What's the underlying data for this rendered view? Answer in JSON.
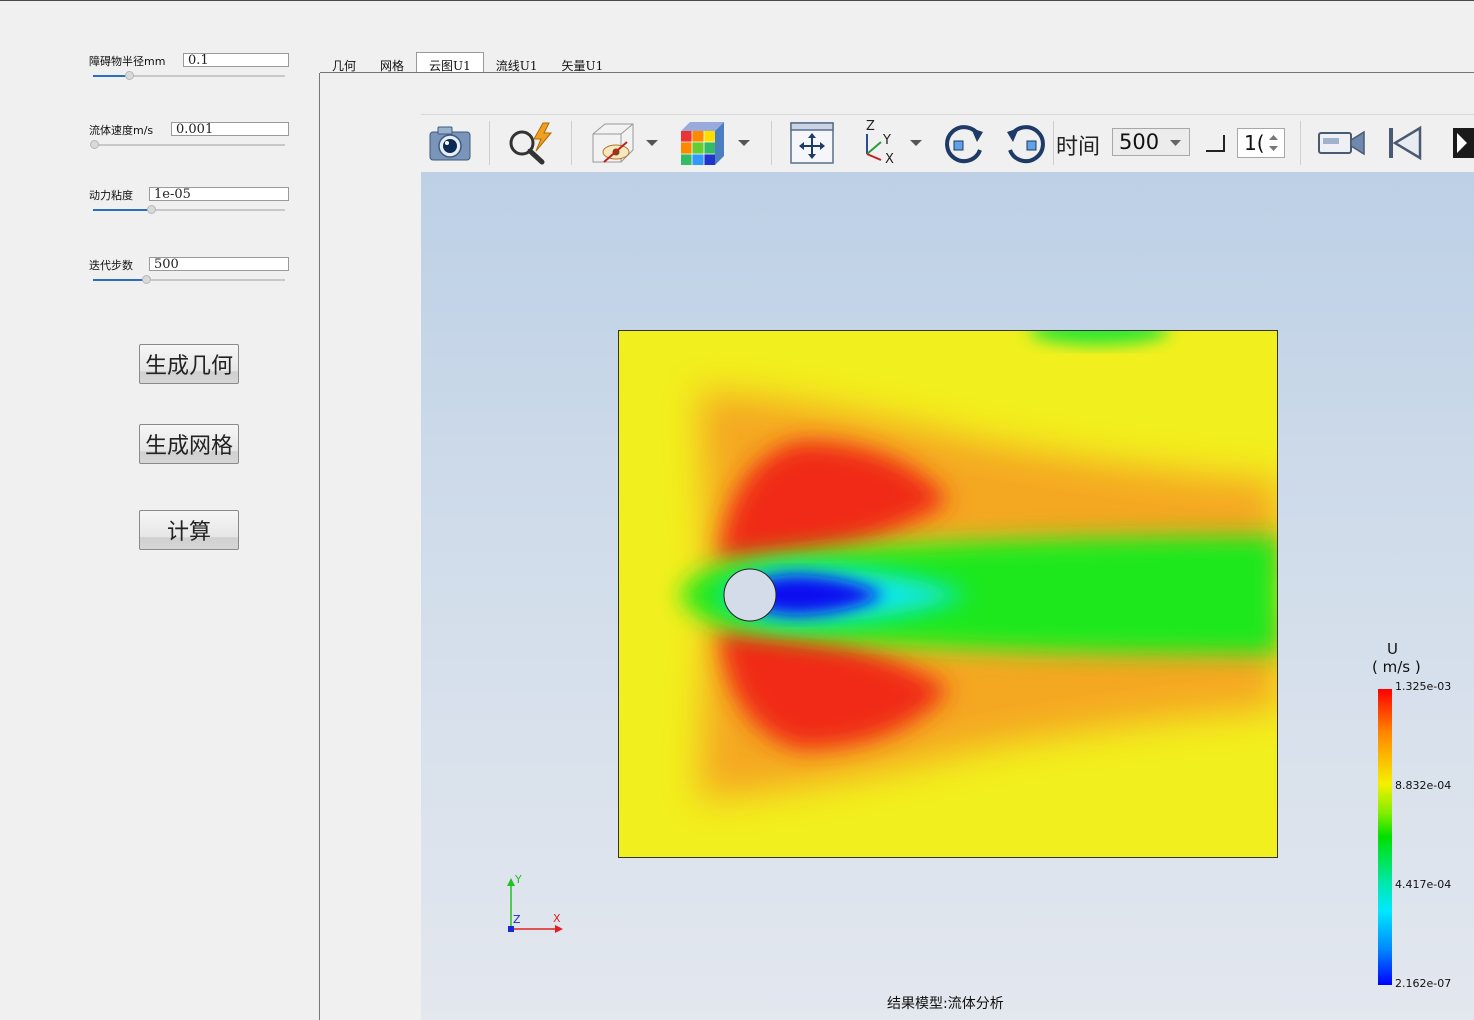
{
  "params": [
    {
      "label": "障碍物半径mm",
      "value": "0.1"
    },
    {
      "label": "流体速度m/s",
      "value": "0.001"
    },
    {
      "label": "动力粘度",
      "value": "1e-05"
    },
    {
      "label": "迭代步数",
      "value": "500"
    }
  ],
  "actions": {
    "geometry": "生成几何",
    "mesh": "生成网格",
    "compute": "计算"
  },
  "tabs": [
    {
      "label": "几何"
    },
    {
      "label": "网格"
    },
    {
      "label": "云图U1",
      "active": true
    },
    {
      "label": "流线U1"
    },
    {
      "label": "矢量U1"
    }
  ],
  "toolbar": {
    "time_label": "时间",
    "time_value": "500",
    "step_value": "1("
  },
  "axes": {
    "y": "Y",
    "z": "Z",
    "x": "X"
  },
  "colorbar": {
    "title": "U",
    "unit": "( m/s )",
    "ticks": [
      "1.325e-03",
      "8.832e-04",
      "4.417e-04",
      "2.162e-07"
    ]
  },
  "status_text": "结果模型:流体分析",
  "icons": [
    "camera-icon",
    "quick-zoom-icon",
    "visibility-icon",
    "dropdown-arrow-icon",
    "color-cube-icon",
    "fit-view-icon",
    "axes-orient-icon",
    "rotate-cw-icon",
    "rotate-ccw-icon",
    "step-icon",
    "record-icon",
    "first-frame-icon",
    "next-frame-icon"
  ]
}
